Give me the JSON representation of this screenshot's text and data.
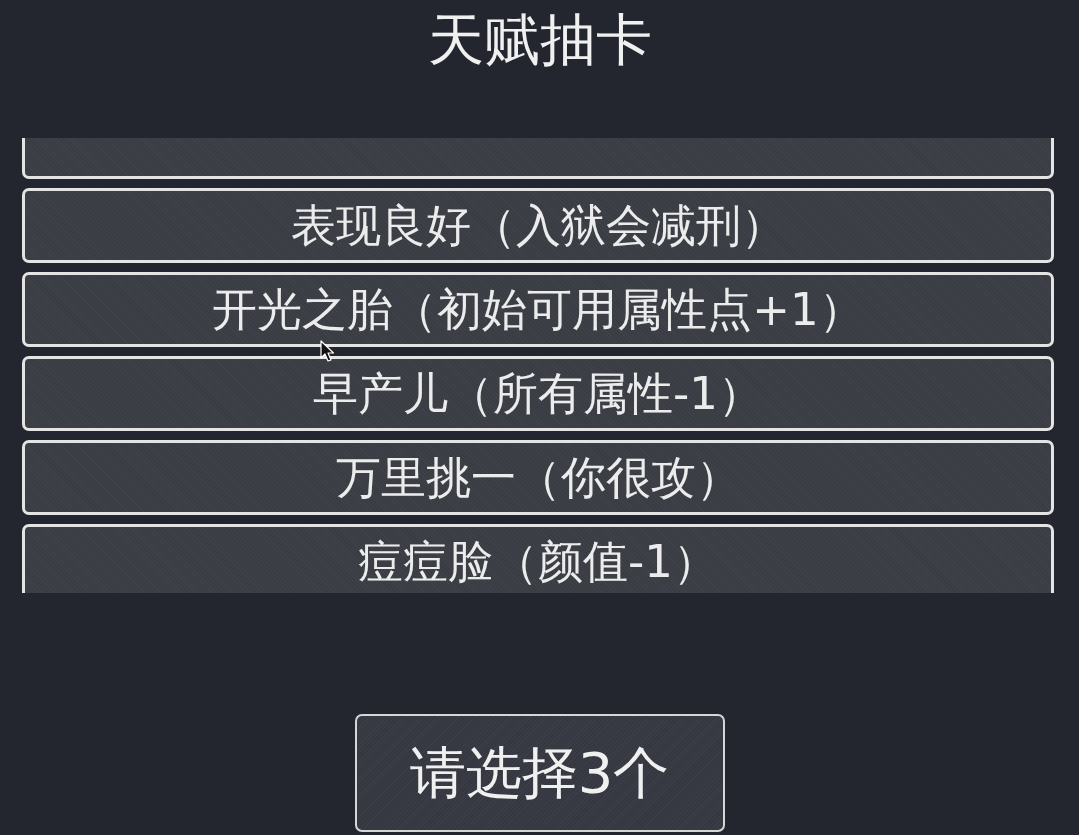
{
  "title": "天赋抽卡",
  "talent_list": {
    "cards": [
      {
        "selected": false
      },
      {
        "label": "表现良好（入狱会减刑）",
        "selected": false
      },
      {
        "label": "开光之胎（初始可用属性点+1）",
        "selected": false
      },
      {
        "label": "早产儿（所有属性-1）",
        "selected": false
      },
      {
        "label": "万里挑一（你很攻）",
        "selected": false
      },
      {
        "label": "痘痘脸（颜值-1）",
        "selected": false
      }
    ]
  },
  "confirm_button": {
    "label": "请选择3个"
  }
}
